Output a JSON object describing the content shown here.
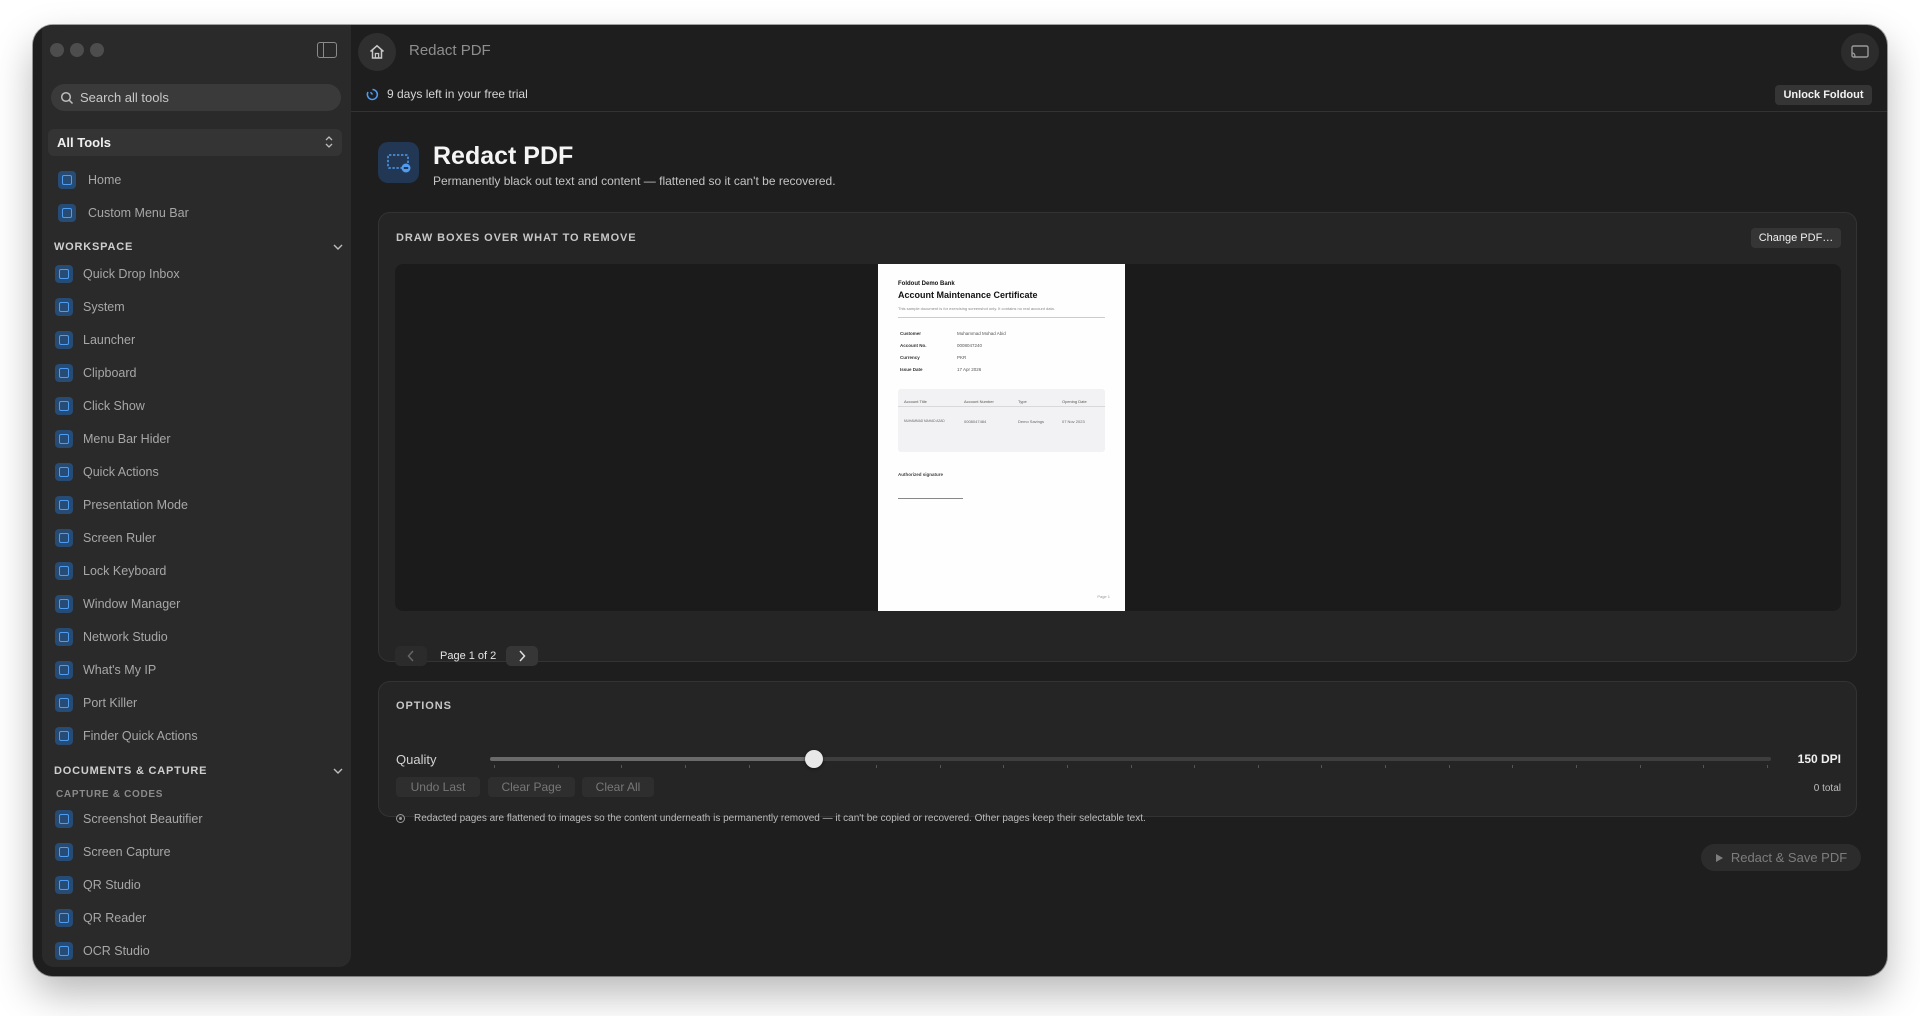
{
  "window": {
    "title": "Redact PDF"
  },
  "sidebar": {
    "search_placeholder": "Search all tools",
    "selector_value": "All Tools",
    "top_items": [
      {
        "label": "Home",
        "icon": "home-icon"
      },
      {
        "label": "Custom Menu Bar",
        "icon": "menu-bar-icon"
      }
    ],
    "workspace": {
      "heading": "WORKSPACE",
      "items": [
        {
          "label": "Quick Drop Inbox",
          "icon": "inbox-icon"
        },
        {
          "label": "System",
          "icon": "system-icon"
        },
        {
          "label": "Launcher",
          "icon": "command-icon"
        },
        {
          "label": "Clipboard",
          "icon": "clipboard-icon"
        },
        {
          "label": "Click Show",
          "icon": "click-icon"
        },
        {
          "label": "Menu Bar Hider",
          "icon": "menu-bar-hider-icon"
        },
        {
          "label": "Quick Actions",
          "icon": "quick-actions-icon"
        },
        {
          "label": "Presentation Mode",
          "icon": "presentation-icon"
        },
        {
          "label": "Screen Ruler",
          "icon": "ruler-icon"
        },
        {
          "label": "Lock Keyboard",
          "icon": "lock-icon"
        },
        {
          "label": "Window Manager",
          "icon": "window-manager-icon"
        },
        {
          "label": "Network Studio",
          "icon": "network-icon"
        },
        {
          "label": "What's My IP",
          "icon": "globe-icon"
        },
        {
          "label": "Port Killer",
          "icon": "port-icon"
        },
        {
          "label": "Finder Quick Actions",
          "icon": "finder-icon"
        }
      ]
    },
    "documents": {
      "heading": "DOCUMENTS & CAPTURE",
      "subheading": "CAPTURE & CODES",
      "items": [
        {
          "label": "Screenshot Beautifier",
          "icon": "screenshot-icon"
        },
        {
          "label": "Screen Capture",
          "icon": "capture-icon"
        },
        {
          "label": "QR Studio",
          "icon": "qr-icon"
        },
        {
          "label": "QR Reader",
          "icon": "qr-reader-icon"
        },
        {
          "label": "OCR Studio",
          "icon": "ocr-icon"
        }
      ]
    }
  },
  "banner": {
    "trial_text": "9 days left in your free trial",
    "unlock_label": "Unlock Foldout"
  },
  "tool": {
    "title": "Redact PDF",
    "subtitle": "Permanently black out text and content — flattened so it can't be recovered."
  },
  "preview": {
    "label": "DRAW BOXES OVER WHAT TO REMOVE",
    "change_label": "Change PDF…",
    "page_label": "Page 1 of 2",
    "doc": {
      "bank": "Foldout Demo Bank",
      "title": "Account Maintenance Certificate",
      "note": "This sample document is for exercising screenshot only. It contains no real account data.",
      "fields": [
        {
          "k": "Customer",
          "v": "Muhammad Mohad Abid"
        },
        {
          "k": "Account No.",
          "v": "0008047240"
        },
        {
          "k": "Currency",
          "v": "PKR"
        },
        {
          "k": "Issue Date",
          "v": "17 Apr 2026"
        }
      ],
      "table_headers": [
        "Account Title",
        "Account Number",
        "Type",
        "Opening Date"
      ],
      "table_row": [
        "MUHAMMAD MAHAD AZAD",
        "0008047484",
        "Demo Savings",
        "07 Nov 2023"
      ],
      "signature_label": "Authorized signature",
      "page_number": "Page 1"
    }
  },
  "options": {
    "label": "OPTIONS",
    "quality_label": "Quality",
    "quality_value": "150 DPI",
    "quality_fraction": 0.253,
    "undo_label": "Undo Last",
    "clear_page_label": "Clear Page",
    "clear_all_label": "Clear All",
    "total_text": "0 total",
    "note": "Redacted pages are flattened to images so the content underneath is permanently removed — it can't be copied or recovered. Other pages keep their selectable text."
  },
  "actions": {
    "run_label": "Redact & Save PDF"
  },
  "colors": {
    "accent": "#4f9cf0",
    "icon_bg": "#264b74"
  }
}
